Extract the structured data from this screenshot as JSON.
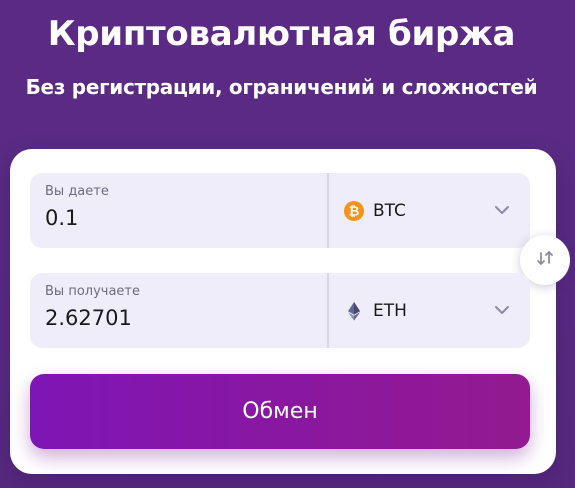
{
  "hero": {
    "title": "Криптовалютная биржа",
    "subtitle": "Без регистрации, ограничений и сложностей"
  },
  "exchange": {
    "give": {
      "label": "Вы даете",
      "amount": "0.1",
      "currency": "BTC",
      "currency_icon": "bitcoin-icon",
      "currency_color": "#f7931a"
    },
    "get": {
      "label": "Вы получаете",
      "amount": "2.62701",
      "currency": "ETH",
      "currency_icon": "ethereum-icon",
      "currency_color": "#627eea"
    },
    "swap_icon": "swap-arrows-icon",
    "submit_label": "Обмен"
  },
  "colors": {
    "background": "#5b2a85",
    "button_gradient_start": "#7e16b5",
    "button_gradient_end": "#931a8f",
    "field_background": "#efedf9"
  }
}
